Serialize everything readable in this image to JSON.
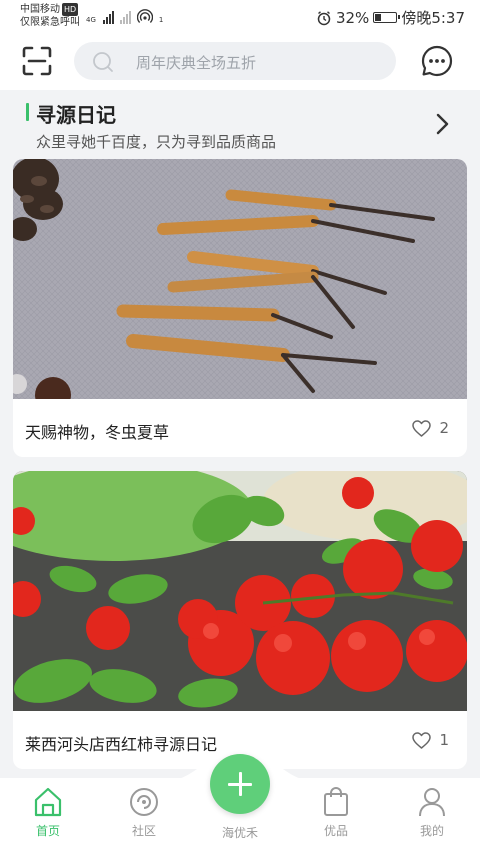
{
  "status_bar": {
    "carrier": "中国移动",
    "carrier_badge": "HD",
    "emergency": "仅限紧急呼叫",
    "network": "4G",
    "hotspot_count": "1",
    "battery_percent": "32%",
    "battery_level": 0.32,
    "time": "傍晚5:37"
  },
  "header": {
    "search_placeholder": "周年庆典全场五折"
  },
  "section": {
    "title": "寻源日记",
    "subtitle": "众里寻她千百度，只为寻到品质商品"
  },
  "cards": [
    {
      "title": "天赐神物，冬虫夏草",
      "likes": "2"
    },
    {
      "title": "莱西河头店西红柿寻源日记",
      "likes": "1"
    }
  ],
  "bottom_nav": {
    "items": [
      {
        "label": "首页"
      },
      {
        "label": "社区"
      },
      {
        "label": "海优禾"
      },
      {
        "label": "优品"
      },
      {
        "label": "我的"
      }
    ]
  },
  "colors": {
    "accent": "#3ac06b",
    "fab": "#5fcf7a",
    "inactive": "#999999"
  }
}
